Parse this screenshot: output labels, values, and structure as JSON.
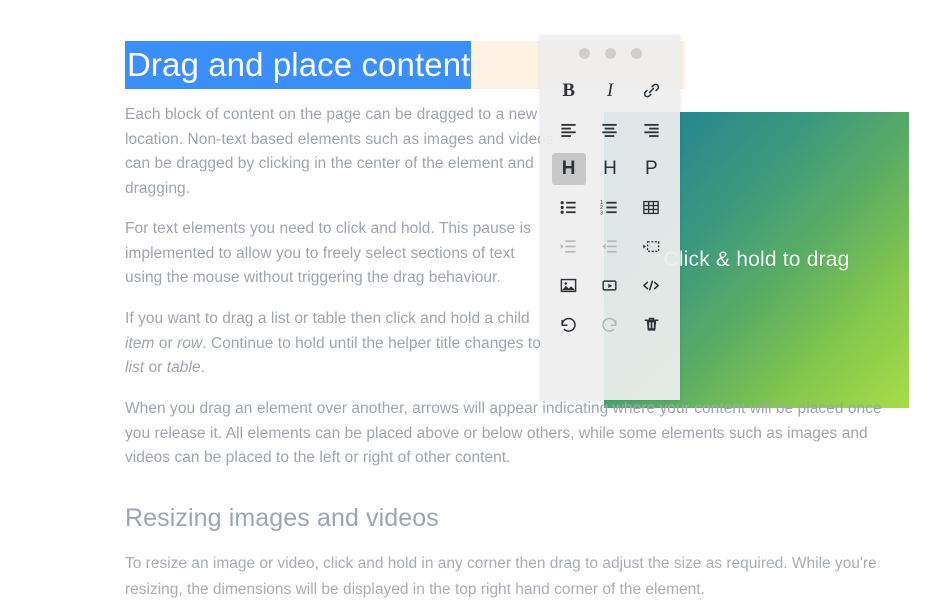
{
  "document": {
    "heading": "Drag and place content",
    "heading_selected": true,
    "paragraphs": [
      {
        "id": "p1",
        "runs": [
          {
            "text": "Each block of content on the page can be dragged to a new location. Non-text based elements such as images and videos can be dragged by clicking in the center of the element and dragging.",
            "italic": false
          }
        ]
      },
      {
        "id": "p2",
        "runs": [
          {
            "text": "For text elements you need to click and hold. This pause is implemented to allow you to freely select sections of text using the mouse without triggering the drag behaviour.",
            "italic": false
          }
        ]
      },
      {
        "id": "p3",
        "runs": [
          {
            "text": "If you want to drag a list or table then click and hold a child ",
            "italic": false
          },
          {
            "text": "item",
            "italic": true
          },
          {
            "text": " or ",
            "italic": false
          },
          {
            "text": "row",
            "italic": true
          },
          {
            "text": ". Continue to hold until the helper title changes to ",
            "italic": false
          },
          {
            "text": "list",
            "italic": true
          },
          {
            "text": " or ",
            "italic": false
          },
          {
            "text": "table",
            "italic": true
          },
          {
            "text": ".",
            "italic": false
          }
        ]
      },
      {
        "id": "p4",
        "runs": [
          {
            "text": "When you drag an element over another, arrows will appear indicating where your content will be placed once you release it. All elements can be placed above or below others, while some elements such as images and videos can be placed to the left or right of other content.",
            "italic": false
          }
        ]
      }
    ],
    "subheading": "Resizing images and videos",
    "closing_paragraph": "To resize an image or video, click and hold in any corner then drag to adjust the size as required. While you're resizing, the dimensions will be displayed in the top right hand corner of the element."
  },
  "media": {
    "drag_label": "Click & hold to drag",
    "gradient_start": "#1f7f91",
    "gradient_end": "#a6dd48"
  },
  "colors": {
    "selection_blue": "#3a8ffb",
    "heading_band_cream": "#fdf2e4",
    "body_text": "#9fa5b0",
    "toolbar_bg": "#eeeeee",
    "toolbar_active_bg": "#c8c8c8",
    "toolbar_icon": "#2e3338",
    "toolbar_icon_disabled": "#b6b8ba"
  },
  "toolbar": {
    "handle_dots": 3,
    "buttons": [
      {
        "name": "bold",
        "label": "B",
        "type": "text",
        "style": "bold-serif",
        "state": "enabled"
      },
      {
        "name": "italic",
        "label": "I",
        "type": "text",
        "style": "italic-serif",
        "state": "enabled"
      },
      {
        "name": "link",
        "label": "",
        "type": "icon",
        "icon": "link-icon",
        "state": "enabled"
      },
      {
        "name": "align-left",
        "label": "",
        "type": "icon",
        "icon": "align-left-icon",
        "state": "enabled"
      },
      {
        "name": "align-center",
        "label": "",
        "type": "icon",
        "icon": "align-center-icon",
        "state": "enabled"
      },
      {
        "name": "align-right",
        "label": "",
        "type": "icon",
        "icon": "align-right-icon",
        "state": "enabled"
      },
      {
        "name": "heading-1",
        "label": "H",
        "type": "text",
        "style": "bold-sans",
        "state": "active"
      },
      {
        "name": "heading-2",
        "label": "H",
        "type": "text",
        "style": "sans",
        "state": "enabled"
      },
      {
        "name": "paragraph",
        "label": "P",
        "type": "text",
        "style": "sans",
        "state": "enabled"
      },
      {
        "name": "bullet-list",
        "label": "",
        "type": "icon",
        "icon": "bullet-list-icon",
        "state": "enabled"
      },
      {
        "name": "numbered-list",
        "label": "",
        "type": "icon",
        "icon": "numbered-list-icon",
        "state": "enabled"
      },
      {
        "name": "table",
        "label": "",
        "type": "icon",
        "icon": "table-icon",
        "state": "enabled"
      },
      {
        "name": "indent",
        "label": "",
        "type": "icon",
        "icon": "indent-icon",
        "state": "disabled"
      },
      {
        "name": "outdent",
        "label": "",
        "type": "icon",
        "icon": "outdent-icon",
        "state": "disabled"
      },
      {
        "name": "page-break",
        "label": "",
        "type": "icon",
        "icon": "page-break-icon",
        "state": "enabled"
      },
      {
        "name": "insert-image",
        "label": "",
        "type": "icon",
        "icon": "image-icon",
        "state": "enabled"
      },
      {
        "name": "insert-video",
        "label": "",
        "type": "icon",
        "icon": "video-icon",
        "state": "enabled"
      },
      {
        "name": "insert-code",
        "label": "",
        "type": "icon",
        "icon": "code-icon",
        "state": "enabled"
      },
      {
        "name": "undo",
        "label": "",
        "type": "icon",
        "icon": "undo-icon",
        "state": "enabled"
      },
      {
        "name": "redo",
        "label": "",
        "type": "icon",
        "icon": "redo-icon",
        "state": "disabled"
      },
      {
        "name": "delete",
        "label": "",
        "type": "icon",
        "icon": "trash-icon",
        "state": "enabled"
      }
    ]
  }
}
